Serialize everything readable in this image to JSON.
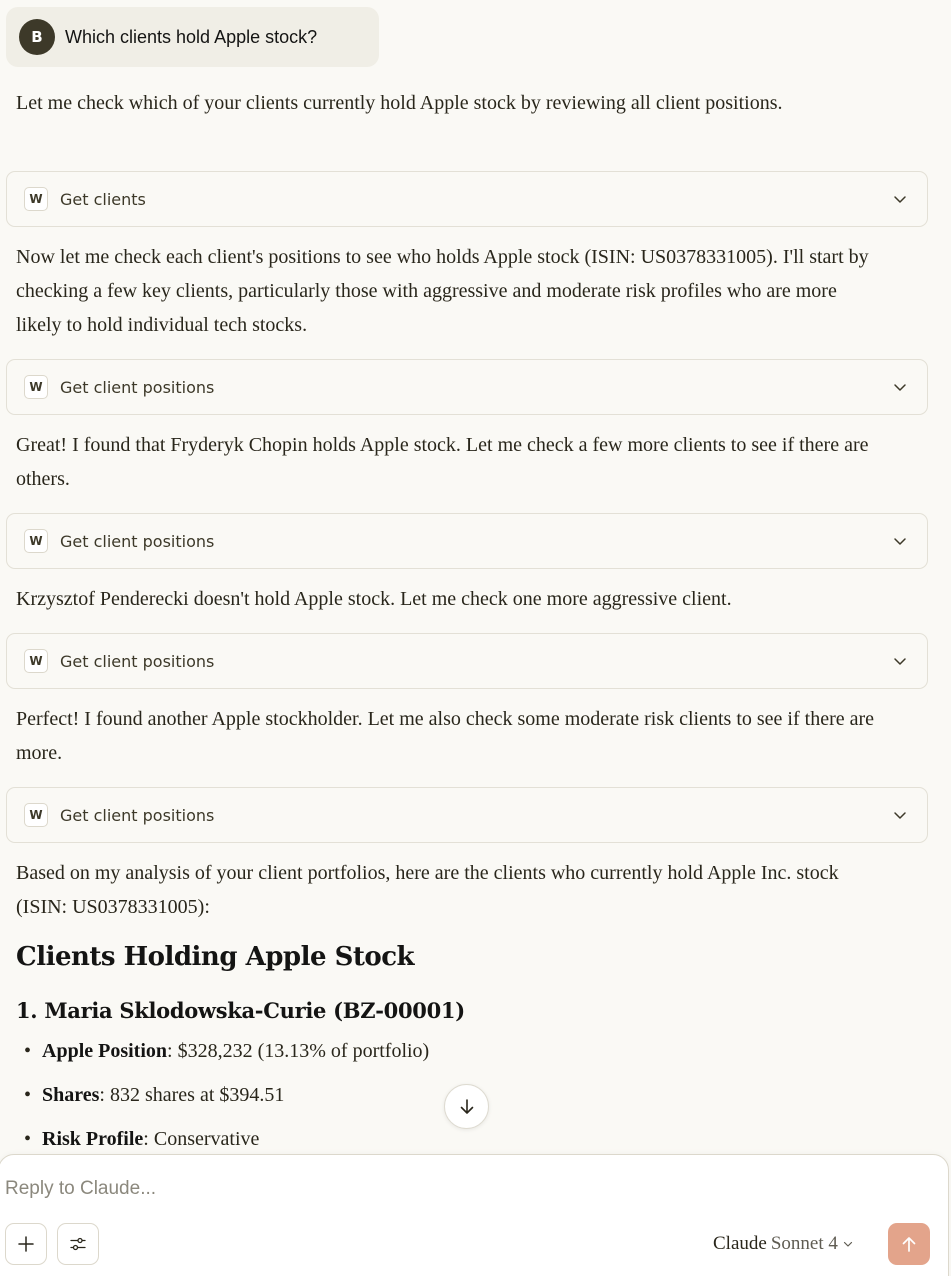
{
  "user_message": {
    "avatar_initial": "B",
    "text": "Which clients hold Apple stock?"
  },
  "messages": [
    "Let me check which of your clients currently hold Apple stock by reviewing all client positions.",
    "Now let me check each client's positions to see who holds Apple stock (ISIN: US0378331005). I'll start by checking a few key clients, particularly those with aggressive and moderate risk profiles who are more likely to hold individual tech stocks.",
    "Great! I found that Fryderyk Chopin holds Apple stock. Let me check a few more clients to see if there are others.",
    "Krzysztof Penderecki doesn't hold Apple stock. Let me check one more aggressive client.",
    "Perfect! I found another Apple stockholder. Let me also check some moderate risk clients to see if there are more.",
    "Based on my analysis of your client portfolios, here are the clients who currently hold Apple Inc. stock (ISIN: US0378331005):"
  ],
  "tool_calls": [
    {
      "icon": "W",
      "label": "Get clients"
    },
    {
      "icon": "W",
      "label": "Get client positions"
    },
    {
      "icon": "W",
      "label": "Get client positions"
    },
    {
      "icon": "W",
      "label": "Get client positions"
    },
    {
      "icon": "W",
      "label": "Get client positions"
    }
  ],
  "summary": {
    "heading": "Clients Holding Apple Stock",
    "client_heading": "1. Maria Sklodowska-Curie (BZ-00001)",
    "bullets": [
      {
        "label": "Apple Position",
        "value": ": $328,232 (13.13% of portfolio)"
      },
      {
        "label": "Shares",
        "value": ": 832 shares at $394.51"
      },
      {
        "label": "Risk Profile",
        "value": ": Conservative"
      }
    ]
  },
  "composer": {
    "placeholder": "Reply to Claude...",
    "model_name": "Claude",
    "model_version": "Sonnet 4",
    "add_icon": "plus-icon",
    "settings_icon": "sliders-icon",
    "send_icon": "arrow-up-icon"
  },
  "colors": {
    "background": "#faf9f5",
    "send_button": "#e3a48b",
    "avatar": "#3d3929"
  }
}
